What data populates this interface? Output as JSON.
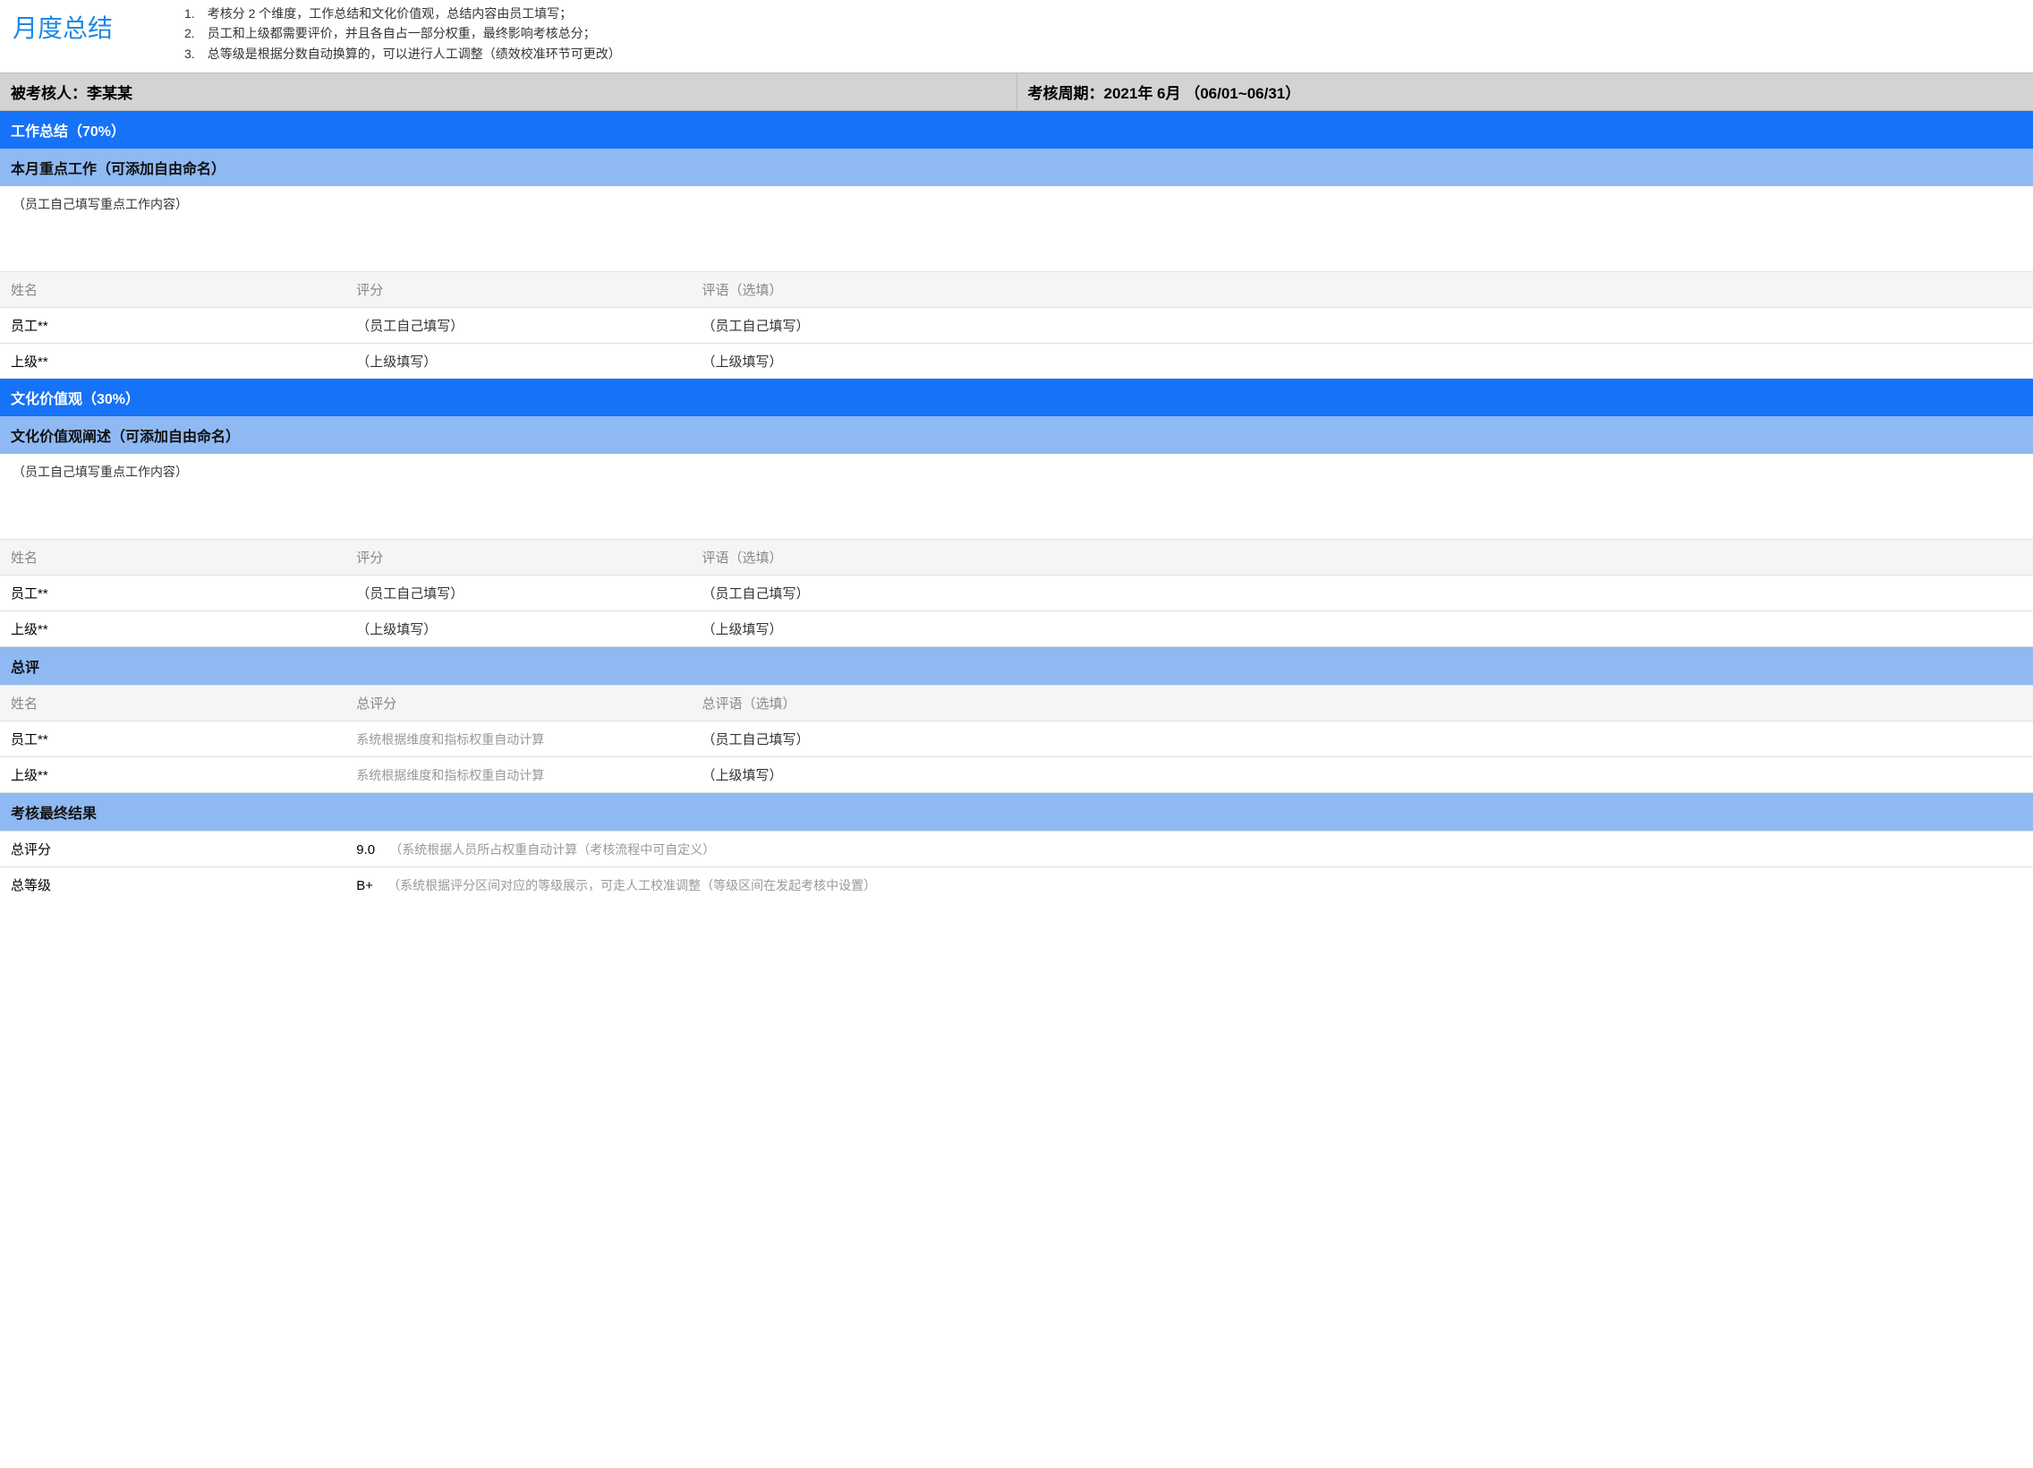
{
  "header": {
    "title": "月度总结",
    "instructions": [
      "1.　考核分 2 个维度，工作总结和文化价值观，总结内容由员工填写；",
      "2.　员工和上级都需要评价，并且各自占一部分权重，最终影响考核总分；",
      "3.　总等级是根据分数自动换算的，可以进行人工调整（绩效校准环节可更改）"
    ]
  },
  "info": {
    "evaluee": "被考核人：李某某",
    "period": "考核周期：2021年 6月 （06/01~06/31）"
  },
  "section_work": {
    "title": "工作总结（70%）",
    "subtitle": "本月重点工作（可添加自由命名）",
    "content_placeholder": "（员工自己填写重点工作内容）",
    "columns": {
      "name": "姓名",
      "score": "评分",
      "comment": "评语（选填）"
    },
    "rows": [
      {
        "name": "员工**",
        "score": "（员工自己填写）",
        "comment": "（员工自己填写）"
      },
      {
        "name": "上级**",
        "score": "（上级填写）",
        "comment": "（上级填写）"
      }
    ]
  },
  "section_culture": {
    "title": "文化价值观（30%）",
    "subtitle": "文化价值观阐述（可添加自由命名）",
    "content_placeholder": "（员工自己填写重点工作内容）",
    "columns": {
      "name": "姓名",
      "score": "评分",
      "comment": "评语（选填）"
    },
    "rows": [
      {
        "name": "员工**",
        "score": "（员工自己填写）",
        "comment": "（员工自己填写）"
      },
      {
        "name": "上级**",
        "score": "（上级填写）",
        "comment": "（上级填写）"
      }
    ]
  },
  "summary": {
    "title": "总评",
    "columns": {
      "name": "姓名",
      "score": "总评分",
      "comment": "总评语（选填）"
    },
    "rows": [
      {
        "name": "员工**",
        "score": "系统根据维度和指标权重自动计算",
        "comment": "（员工自己填写）"
      },
      {
        "name": "上级**",
        "score": "系统根据维度和指标权重自动计算",
        "comment": "（上级填写）"
      }
    ]
  },
  "final": {
    "title": "考核最终结果",
    "score_label": "总评分",
    "score_value": "9.0",
    "score_note": "（系统根据人员所占权重自动计算（考核流程中可自定义）",
    "grade_label": "总等级",
    "grade_value": "B+",
    "grade_note": "（系统根据评分区间对应的等级展示，可走人工校准调整（等级区间在发起考核中设置）"
  }
}
